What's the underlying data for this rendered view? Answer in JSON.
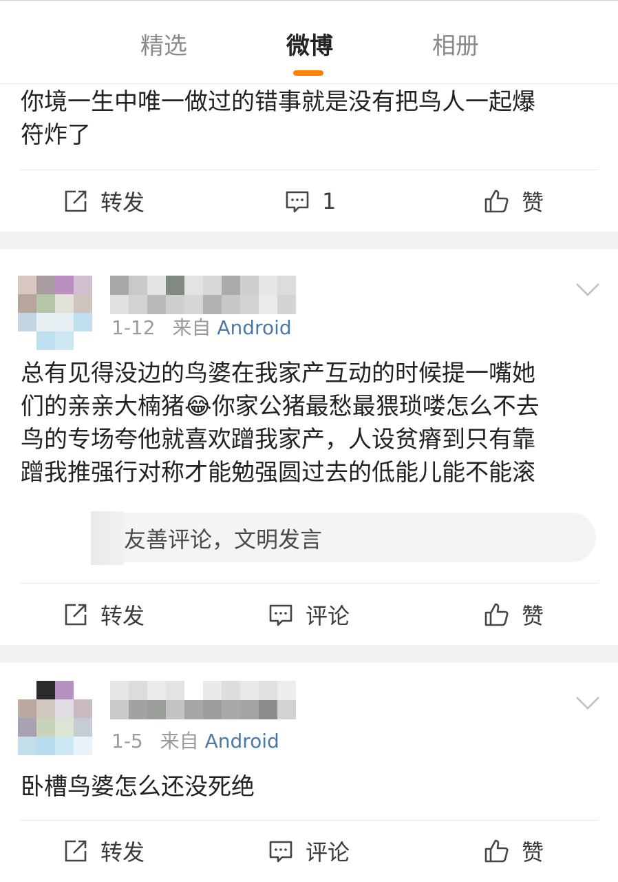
{
  "tabs": [
    {
      "label": "精选"
    },
    {
      "label": "微博"
    },
    {
      "label": "相册"
    }
  ],
  "active_tab_color": "#ff8200",
  "post1": {
    "text_lines": [
      "你境一生中唯一做过的错事就是没有把鸟人一起爆",
      "符炸了"
    ],
    "actions": {
      "repost": "转发",
      "comment": "1",
      "like": "赞"
    }
  },
  "post2": {
    "meta_date": "1-12",
    "meta_from": "来自",
    "meta_source": "Android",
    "text_lines": [
      "总有见得没边的鸟婆在我家产互动的时候提一嘴她",
      "们的亲亲大楠猪😂你家公猪最愁最猥琐喽怎么不去",
      "鸟的专场夸他就喜欢蹭我家产，人设贫瘠到只有靠",
      "蹭我推强行对称才能勉强圆过去的低能儿能不能滚"
    ],
    "comment_placeholder": "友善评论，文明发言",
    "actions": {
      "repost": "转发",
      "comment": "评论",
      "like": "赞"
    }
  },
  "post3": {
    "meta_date": "1-5",
    "meta_from": "来自",
    "meta_source": "Android",
    "text_lines": [
      "卧槽鸟婆怎么还没死绝"
    ],
    "actions": {
      "repost": "转发",
      "comment": "评论",
      "like": "赞"
    }
  },
  "icons": {
    "repost": "share-icon",
    "comment": "comment-icon",
    "like": "thumbs-up-icon",
    "more": "chevron-down-icon"
  }
}
